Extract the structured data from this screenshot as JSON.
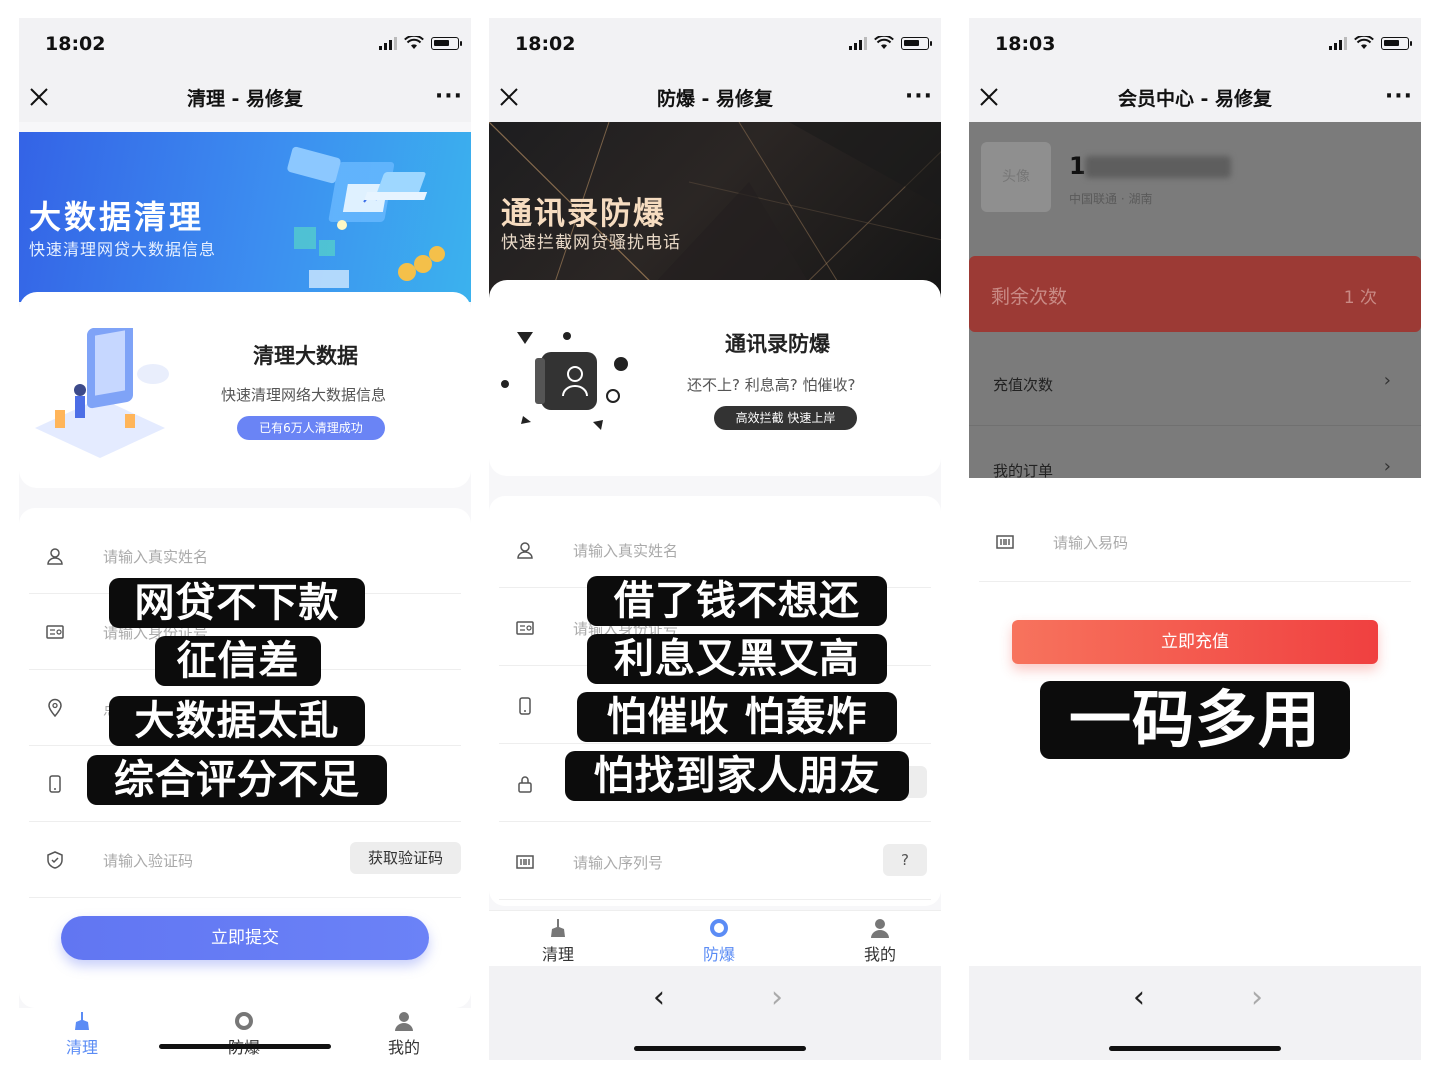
{
  "phones": [
    {
      "time": "18:02",
      "title": "清理 - 易修复",
      "banner_title": "大数据清理",
      "banner_sub": "快速清理网贷大数据信息",
      "card_title": "清理大数据",
      "card_desc": "快速清理网络大数据信息",
      "card_pill": "已有6万人清理成功",
      "fields": [
        "请输入真实姓名",
        "请输入身份证号",
        "",
        "",
        "请输入验证码"
      ],
      "partial_field": "点",
      "code_button": "获取验证码",
      "submit": "立即提交",
      "tabs": [
        "清理",
        "防爆",
        "我的"
      ],
      "captions": [
        "网贷不下款",
        "征信差",
        "大数据太乱",
        "综合评分不足"
      ]
    },
    {
      "time": "18:02",
      "title": "防爆 - 易修复",
      "banner_title": "通讯录防爆",
      "banner_sub": "快速拦截网贷骚扰电话",
      "card_title": "通讯录防爆",
      "card_desc": "还不上? 利息高? 怕催收?",
      "card_pill": "高效拦截 快速上岸",
      "fields": [
        "请输入真实姓名",
        "请输入身份证号",
        "",
        "",
        "请输入序列号"
      ],
      "q_mark": "?",
      "tabs": [
        "清理",
        "防爆",
        "我的"
      ],
      "captions": [
        "借了钱不想还",
        "利息又黑又高",
        "怕催收 怕轰炸",
        "怕找到家人朋友"
      ],
      "nav_back": "‹",
      "nav_forward": "›"
    },
    {
      "time": "18:03",
      "title": "会员中心 - 易修复",
      "avatar_text": "头像",
      "user_number": "1",
      "carrier": "中国联通 · 湖南",
      "remaining_label": "剩余次数",
      "remaining_value": "1 次",
      "menu": [
        "充值次数",
        "我的订单"
      ],
      "code_placeholder": "请输入易码",
      "recharge": "立即充值",
      "caption": "一码多用",
      "nav_back": "‹",
      "nav_forward": "›"
    }
  ],
  "colors": {
    "accent_blue": "#6176f2",
    "accent_red": "#f04040",
    "caption_bg": "#0c0c0c"
  }
}
